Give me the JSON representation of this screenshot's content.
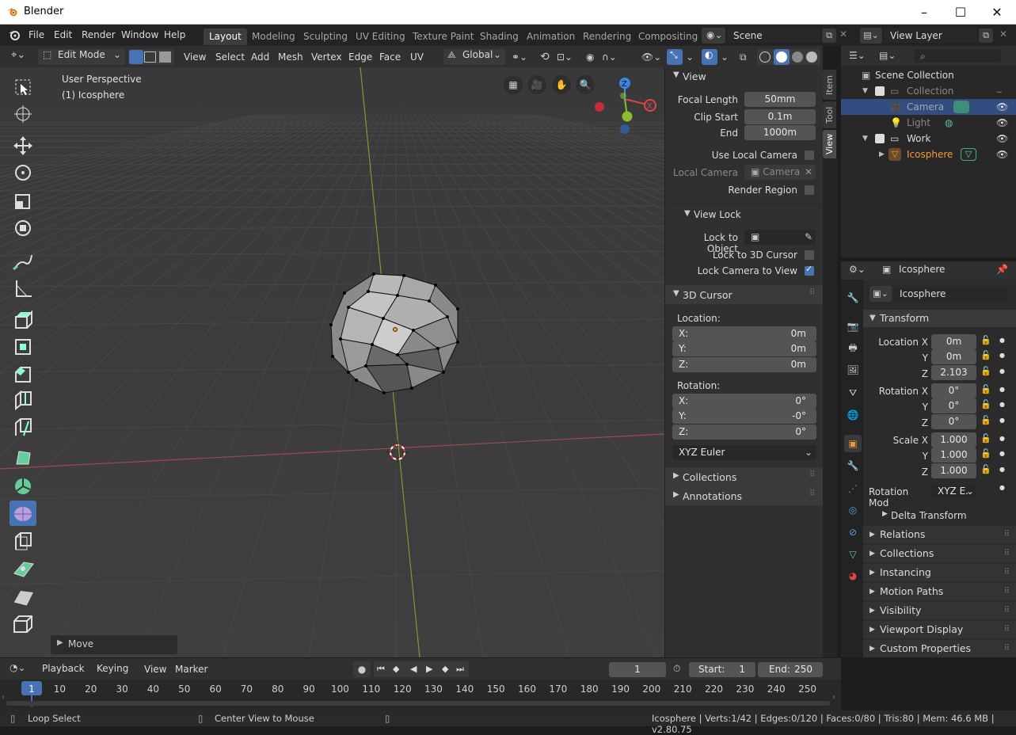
{
  "window": {
    "title": "Blender"
  },
  "menu": {
    "items": [
      "File",
      "Edit",
      "Render",
      "Window",
      "Help"
    ]
  },
  "workspaces": [
    "Layout",
    "Modeling",
    "Sculpting",
    "UV Editing",
    "Texture Paint",
    "Shading",
    "Animation",
    "Rendering",
    "Compositing"
  ],
  "scene": {
    "name": "Scene",
    "view_layer": "View Layer"
  },
  "header3d": {
    "mode": "Edit Mode",
    "menus": [
      "View",
      "Select",
      "Add",
      "Mesh",
      "Vertex",
      "Edge",
      "Face",
      "UV"
    ],
    "orientation": "Global"
  },
  "viewport": {
    "perspective": "User Perspective",
    "object": "(1) Icosphere",
    "gizmo": {
      "x": "X",
      "y": "Y",
      "z": "Z"
    },
    "last_op": "Move"
  },
  "npanel": {
    "tabs": [
      "Item",
      "Tool",
      "View"
    ],
    "view": {
      "title": "View",
      "focal_length_label": "Focal Length",
      "focal_length": "50mm",
      "clip_start_label": "Clip Start",
      "clip_start": "0.1m",
      "end_label": "End",
      "clip_end": "1000m",
      "use_local_camera": "Use Local Camera",
      "local_camera_label": "Local Camera",
      "local_camera": "Camera",
      "render_region": "Render Region"
    },
    "view_lock": {
      "title": "View Lock",
      "lock_to_object": "Lock to Object",
      "lock_3d_cursor": "Lock to 3D Cursor",
      "lock_camera": "Lock Camera to View"
    },
    "cursor": {
      "title": "3D Cursor",
      "location": "Location:",
      "lx": "X:",
      "ly": "Y:",
      "lz": "Z:",
      "vx": "0m",
      "vy": "0m",
      "vz": "0m",
      "rotation": "Rotation:",
      "rx": "0°",
      "ry": "-0°",
      "rz": "0°",
      "mode": "XYZ Euler"
    },
    "collections": "Collections",
    "annotations": "Annotations"
  },
  "outliner": {
    "root": "Scene Collection",
    "collection": "Collection",
    "camera": "Camera",
    "light": "Light",
    "work": "Work",
    "icosphere": "Icosphere"
  },
  "properties": {
    "object": "Icosphere",
    "datablock": "Icosphere",
    "transform": {
      "title": "Transform",
      "loc": "Location X",
      "y": "Y",
      "z": "Z",
      "lx": "0m",
      "ly": "0m",
      "lz": "2.103",
      "rot": "Rotation X",
      "rx": "0°",
      "ry": "0°",
      "rz": "0°",
      "scale": "Scale X",
      "sx": "1.000",
      "sy": "1.000",
      "sz": "1.000",
      "rotmode_label": "Rotation Mod",
      "rotmode": "XYZ E.."
    },
    "delta": "Delta Transform",
    "sections": [
      "Relations",
      "Collections",
      "Instancing",
      "Motion Paths",
      "Visibility",
      "Viewport Display",
      "Custom Properties"
    ]
  },
  "timeline": {
    "menus": [
      "Playback",
      "Keying",
      "View",
      "Marker"
    ],
    "current": "1",
    "start_label": "Start:",
    "start": "1",
    "end_label": "End:",
    "end": "250",
    "ticks": [
      "1",
      "10",
      "20",
      "30",
      "40",
      "50",
      "60",
      "70",
      "80",
      "90",
      "100",
      "110",
      "120",
      "130",
      "140",
      "150",
      "160",
      "170",
      "180",
      "190",
      "200",
      "210",
      "220",
      "230",
      "240",
      "250"
    ]
  },
  "status": {
    "left": "Loop Select",
    "mid": "Center View to Mouse",
    "right": "Icosphere | Verts:1/42 | Edges:0/120 | Faces:0/80 | Tris:80 | Mem: 46.6 MB | v2.80.75"
  }
}
